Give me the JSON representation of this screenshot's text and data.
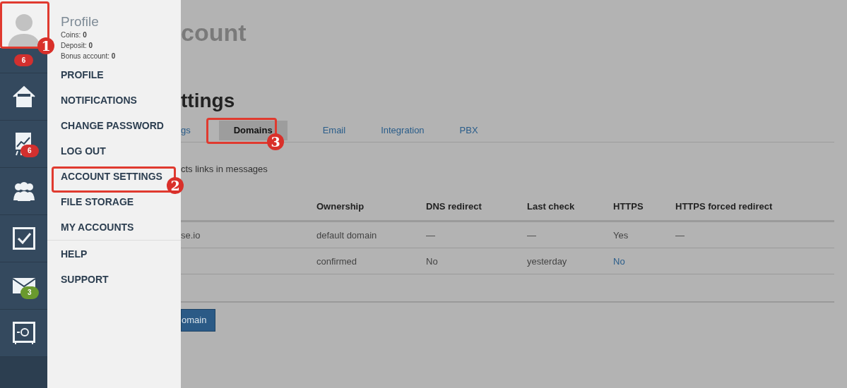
{
  "sidebar": {
    "avatar_badge": {
      "text": "6",
      "color": "#d3302f"
    },
    "items": [
      {
        "kind": "home"
      },
      {
        "kind": "chart",
        "badge": {
          "text": "6",
          "color": "#d3302f"
        }
      },
      {
        "kind": "users"
      },
      {
        "kind": "tasks"
      },
      {
        "kind": "mail",
        "badge": {
          "text": "3",
          "color": "#6a9a2e"
        }
      },
      {
        "kind": "safe"
      }
    ]
  },
  "menu": {
    "title": "Profile",
    "stats": [
      {
        "label": "Coins:",
        "value": "0"
      },
      {
        "label": "Deposit:",
        "value": "0"
      },
      {
        "label": "Bonus account:",
        "value": "0"
      }
    ],
    "groups": [
      [
        "PROFILE",
        "NOTIFICATIONS",
        "CHANGE PASSWORD",
        "LOG OUT",
        "ACCOUNT SETTINGS",
        "FILE STORAGE",
        "MY ACCOUNTS"
      ],
      [
        "HELP",
        "SUPPORT"
      ]
    ]
  },
  "main": {
    "page_title": "count",
    "section_title": "ttings",
    "tabs": [
      {
        "label": "gs",
        "selected": false
      },
      {
        "label": "Domains",
        "selected": true
      },
      {
        "label": "Email",
        "selected": false
      },
      {
        "label": "Integration",
        "selected": false
      },
      {
        "label": "PBX",
        "selected": false
      }
    ],
    "note": "cts links in messages",
    "table": {
      "columns": [
        "",
        "Ownership",
        "DNS redirect",
        "Last check",
        "HTTPS",
        "HTTPS forced redirect"
      ],
      "rows": [
        [
          {
            "text": "se.io",
            "kind": "text"
          },
          {
            "text": "default domain",
            "kind": "text"
          },
          {
            "text": "—",
            "kind": "text"
          },
          {
            "text": "—",
            "kind": "text"
          },
          {
            "text": "Yes",
            "kind": "text"
          },
          {
            "text": "—",
            "kind": "text"
          }
        ],
        [
          null,
          {
            "text": "confirmed",
            "kind": "text"
          },
          {
            "text": "No",
            "kind": "text"
          },
          {
            "text": "yesterday",
            "kind": "text"
          },
          {
            "text": "No",
            "kind": "link"
          },
          null
        ]
      ]
    },
    "button": "omain"
  },
  "callouts": [
    "1",
    "2",
    "3"
  ]
}
